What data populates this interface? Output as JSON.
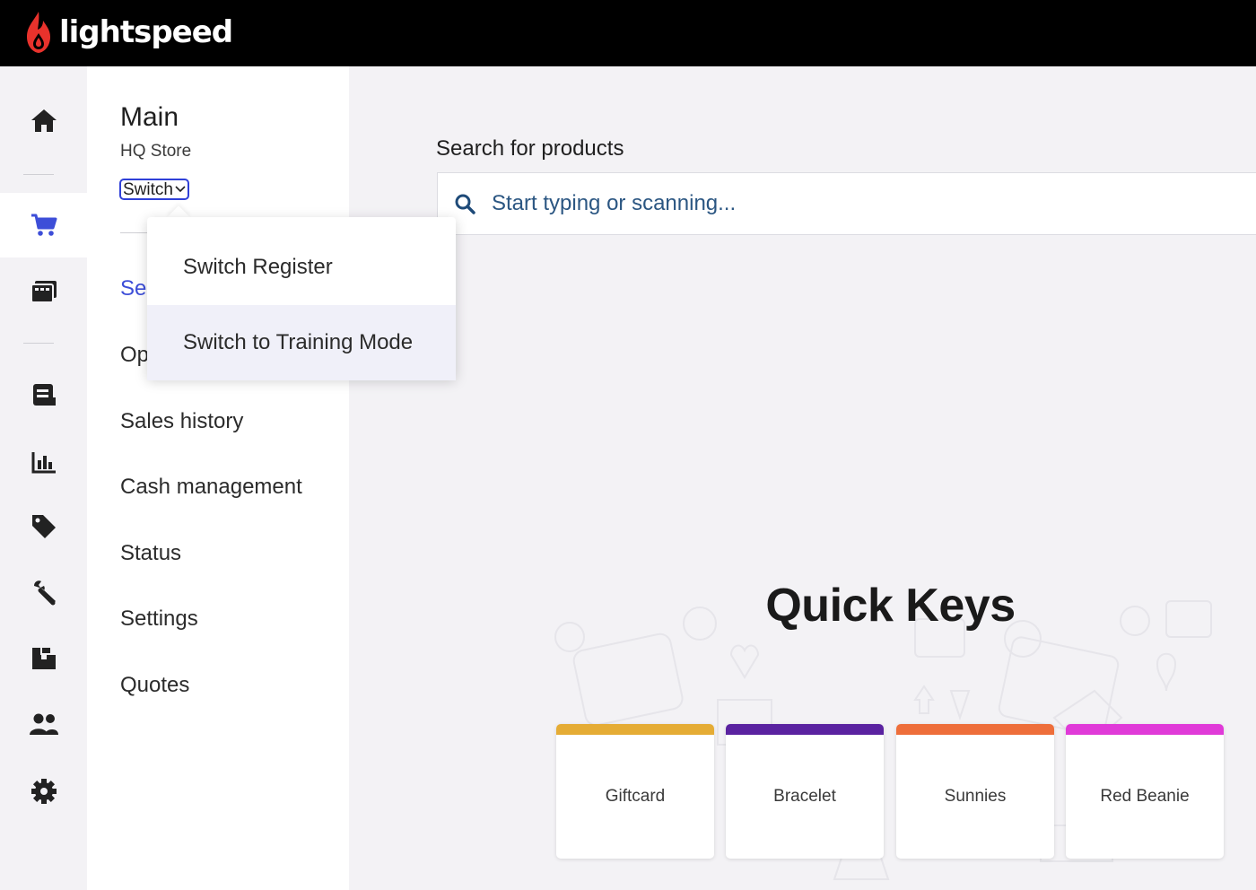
{
  "brand": {
    "name": "lightspeed",
    "logo_color": "#e8322c"
  },
  "rail": {
    "items": [
      {
        "icon": "home-icon",
        "active": false
      },
      {
        "icon": "cart-icon",
        "active": true,
        "color": "#3d4ed8"
      },
      {
        "icon": "register-icon",
        "active": false
      },
      {
        "icon": "receipt-icon",
        "active": false
      },
      {
        "icon": "reports-icon",
        "active": false
      },
      {
        "icon": "tag-icon",
        "active": false
      },
      {
        "icon": "wrench-icon",
        "active": false
      },
      {
        "icon": "inventory-icon",
        "active": false
      },
      {
        "icon": "customers-icon",
        "active": false
      },
      {
        "icon": "gear-icon",
        "active": false
      }
    ]
  },
  "panel": {
    "title": "Main",
    "subtitle": "HQ Store",
    "switch_label": "Switch",
    "nav": [
      {
        "label": "Sel",
        "active": true
      },
      {
        "label": "Op",
        "active": false
      },
      {
        "label": "Sales history",
        "active": false
      },
      {
        "label": "Cash management",
        "active": false
      },
      {
        "label": "Status",
        "active": false
      },
      {
        "label": "Settings",
        "active": false
      },
      {
        "label": "Quotes",
        "active": false
      }
    ]
  },
  "dropdown": {
    "items": [
      {
        "label": "Switch Register"
      },
      {
        "label": "Switch to Training Mode",
        "hovered": true
      }
    ]
  },
  "search": {
    "label": "Search for products",
    "placeholder": "Start typing or scanning..."
  },
  "quick_keys": {
    "title": "Quick Keys",
    "cards": [
      {
        "label": "Giftcard",
        "color": "#e5ac35"
      },
      {
        "label": "Bracelet",
        "color": "#5a22a0"
      },
      {
        "label": "Sunnies",
        "color": "#ee6e3a"
      },
      {
        "label": "Red Beanie",
        "color": "#e03ad8"
      }
    ]
  }
}
